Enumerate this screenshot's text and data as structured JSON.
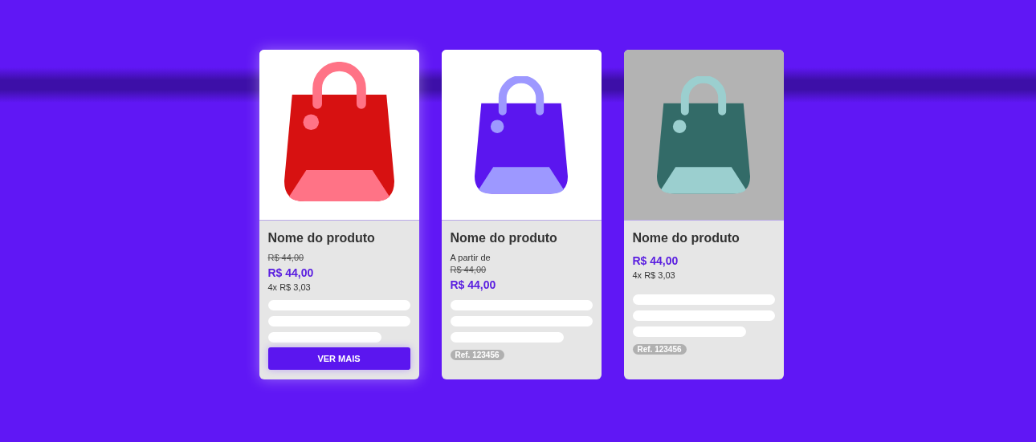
{
  "products": [
    {
      "name": "Nome do produto",
      "highlighted": true,
      "image": {
        "color": "#ffffff"
      },
      "bag": {
        "color": "#d71111"
      },
      "bag_accent": {
        "color": "#ff7386"
      },
      "old_price": "R$ 44,00",
      "price": "R$ 44,00",
      "installments": "4x R$ 3,03",
      "button": "VER MAIS"
    },
    {
      "name": "Nome do produto",
      "highlighted": false,
      "image": {
        "color": "#ffffff"
      },
      "bag": {
        "color": "#5b16ef"
      },
      "bag_accent": {
        "color": "#9d98ff"
      },
      "from_label": "A partir de",
      "old_price": "R$ 44,00",
      "price": "R$ 44,00",
      "ref": "Ref. 123456"
    },
    {
      "name": "Nome do produto",
      "highlighted": false,
      "image": {
        "color": "#b3b3b3"
      },
      "bag": {
        "color": "#336b68"
      },
      "bag_accent": {
        "color": "#9bcfcf"
      },
      "price": "R$ 44,00",
      "installments": "4x R$ 3,03",
      "ref": "Ref. 123456"
    }
  ]
}
